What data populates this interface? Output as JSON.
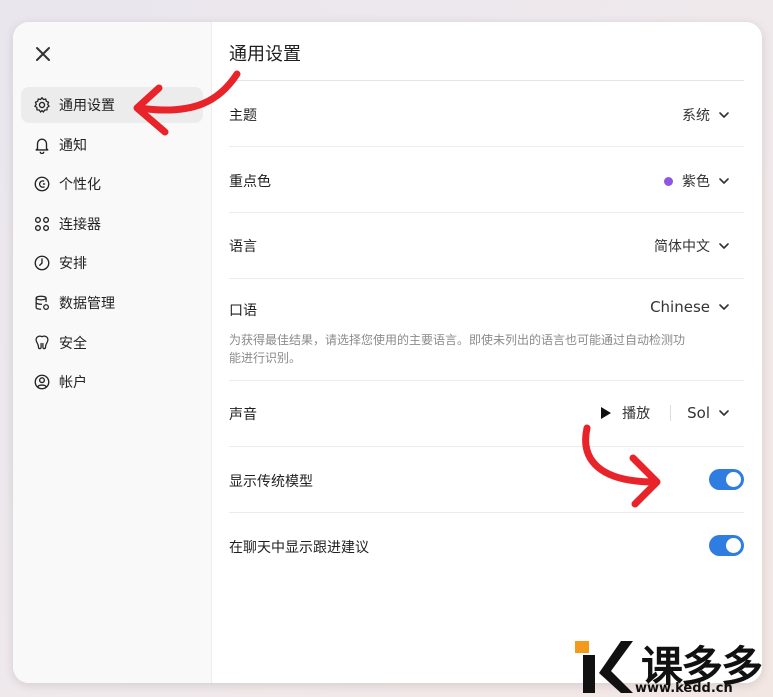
{
  "sidebar": {
    "items": [
      {
        "label": "通用设置",
        "icon": "gear-icon"
      },
      {
        "label": "通知",
        "icon": "bell-icon"
      },
      {
        "label": "个性化",
        "icon": "personalize-icon"
      },
      {
        "label": "连接器",
        "icon": "connectors-icon"
      },
      {
        "label": "安排",
        "icon": "clock-icon"
      },
      {
        "label": "数据管理",
        "icon": "database-icon"
      },
      {
        "label": "安全",
        "icon": "security-icon"
      },
      {
        "label": "帐户",
        "icon": "account-icon"
      }
    ],
    "active_index": 0
  },
  "main": {
    "title": "通用设置",
    "theme": {
      "label": "主题",
      "value": "系统"
    },
    "accent": {
      "label": "重点色",
      "value": "紫色",
      "color": "#8e56e6"
    },
    "language": {
      "label": "语言",
      "value": "简体中文"
    },
    "spoken": {
      "label": "口语",
      "value": "Chinese",
      "description": "为获得最佳结果，请选择您使用的主要语言。即使未列出的语言也可能通过自动检测功能进行识别。"
    },
    "voice": {
      "label": "声音",
      "play_label": "播放",
      "value": "Sol"
    },
    "legacy_models": {
      "label": "显示传统模型",
      "enabled": true
    },
    "follow_up": {
      "label": "在聊天中显示跟进建议",
      "enabled": true
    }
  },
  "colors": {
    "toggle_on": "#2f7de1",
    "annotation_arrow": "#e8232a",
    "logo_orange": "#f39a1c"
  },
  "watermark": {
    "brand": "课多多",
    "url": "www.kedd.cn"
  }
}
